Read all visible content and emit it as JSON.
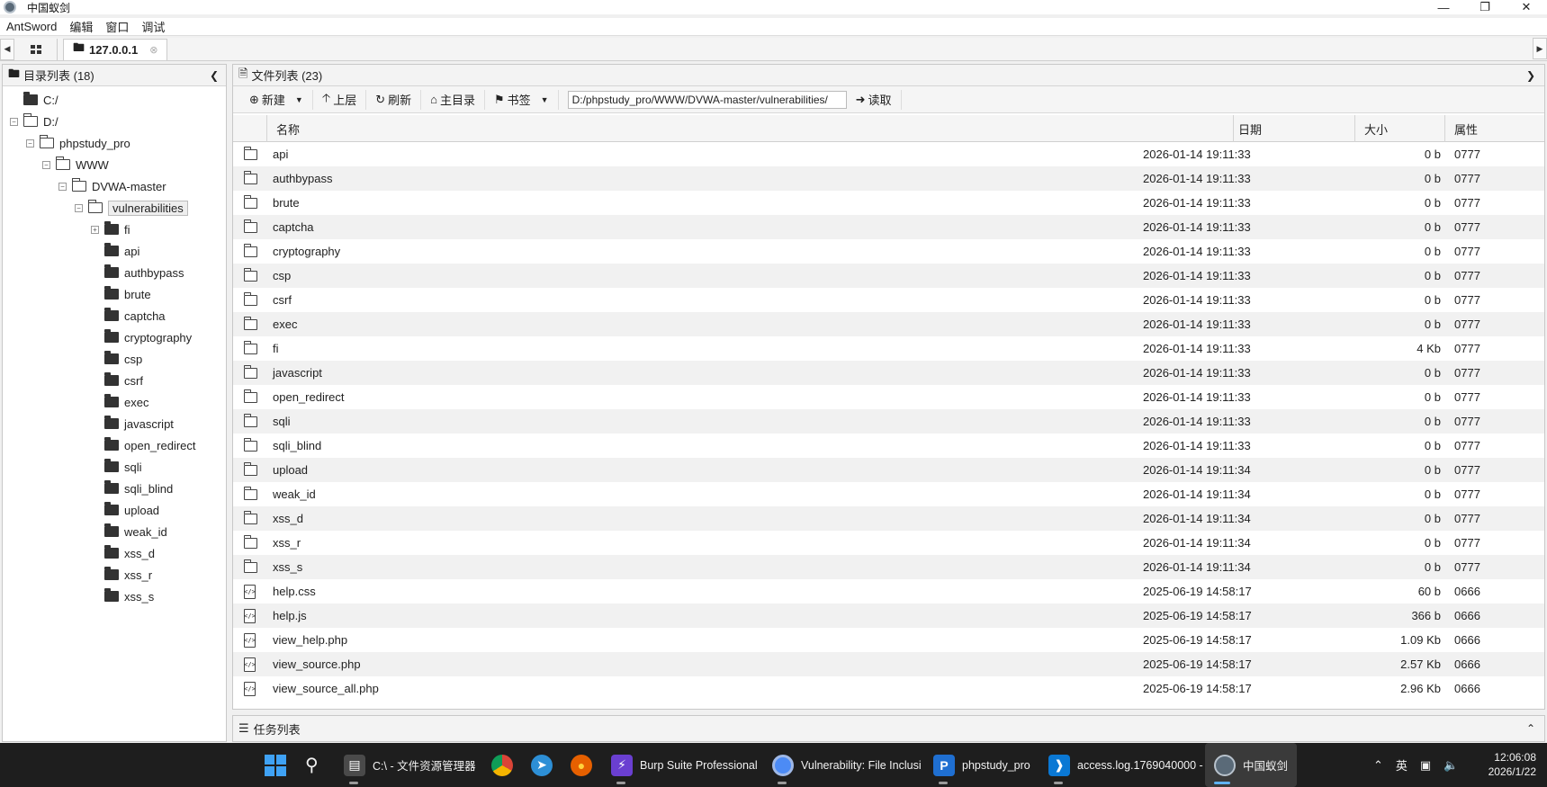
{
  "window": {
    "title": "中国蚁剑"
  },
  "menu": [
    "AntSword",
    "编辑",
    "窗口",
    "调试"
  ],
  "tabs": {
    "active_label": "127.0.0.1"
  },
  "dir_panel": {
    "title": "目录列表 (18)",
    "tree": [
      {
        "label": "C:/",
        "depth": 0,
        "icon": "solid",
        "expander": ""
      },
      {
        "label": "D:/",
        "depth": 0,
        "icon": "open",
        "expander": "-"
      },
      {
        "label": "phpstudy_pro",
        "depth": 1,
        "icon": "open",
        "expander": "-"
      },
      {
        "label": "WWW",
        "depth": 2,
        "icon": "open",
        "expander": "-"
      },
      {
        "label": "DVWA-master",
        "depth": 3,
        "icon": "open",
        "expander": "-"
      },
      {
        "label": "vulnerabilities",
        "depth": 4,
        "icon": "open",
        "expander": "-",
        "selected": true
      },
      {
        "label": "fi",
        "depth": 5,
        "icon": "solid",
        "expander": "+"
      },
      {
        "label": "api",
        "depth": 5,
        "icon": "solid",
        "expander": ""
      },
      {
        "label": "authbypass",
        "depth": 5,
        "icon": "solid",
        "expander": ""
      },
      {
        "label": "brute",
        "depth": 5,
        "icon": "solid",
        "expander": ""
      },
      {
        "label": "captcha",
        "depth": 5,
        "icon": "solid",
        "expander": ""
      },
      {
        "label": "cryptography",
        "depth": 5,
        "icon": "solid",
        "expander": ""
      },
      {
        "label": "csp",
        "depth": 5,
        "icon": "solid",
        "expander": ""
      },
      {
        "label": "csrf",
        "depth": 5,
        "icon": "solid",
        "expander": ""
      },
      {
        "label": "exec",
        "depth": 5,
        "icon": "solid",
        "expander": ""
      },
      {
        "label": "javascript",
        "depth": 5,
        "icon": "solid",
        "expander": ""
      },
      {
        "label": "open_redirect",
        "depth": 5,
        "icon": "solid",
        "expander": ""
      },
      {
        "label": "sqli",
        "depth": 5,
        "icon": "solid",
        "expander": ""
      },
      {
        "label": "sqli_blind",
        "depth": 5,
        "icon": "solid",
        "expander": ""
      },
      {
        "label": "upload",
        "depth": 5,
        "icon": "solid",
        "expander": ""
      },
      {
        "label": "weak_id",
        "depth": 5,
        "icon": "solid",
        "expander": ""
      },
      {
        "label": "xss_d",
        "depth": 5,
        "icon": "solid",
        "expander": ""
      },
      {
        "label": "xss_r",
        "depth": 5,
        "icon": "solid",
        "expander": ""
      },
      {
        "label": "xss_s",
        "depth": 5,
        "icon": "solid",
        "expander": ""
      }
    ]
  },
  "file_panel": {
    "title": "文件列表 (23)",
    "toolbar": {
      "new": "新建",
      "up": "上层",
      "refresh": "刷新",
      "home": "主目录",
      "bookmark": "书签",
      "path": "D:/phpstudy_pro/WWW/DVWA-master/vulnerabilities/",
      "read": "读取"
    },
    "columns": {
      "name": "名称",
      "date": "日期",
      "size": "大小",
      "attr": "属性"
    },
    "files": [
      {
        "name": "api",
        "date": "2026-01-14 19:11:33",
        "size": "0 b",
        "attr": "0777",
        "type": "folder"
      },
      {
        "name": "authbypass",
        "date": "2026-01-14 19:11:33",
        "size": "0 b",
        "attr": "0777",
        "type": "folder"
      },
      {
        "name": "brute",
        "date": "2026-01-14 19:11:33",
        "size": "0 b",
        "attr": "0777",
        "type": "folder"
      },
      {
        "name": "captcha",
        "date": "2026-01-14 19:11:33",
        "size": "0 b",
        "attr": "0777",
        "type": "folder"
      },
      {
        "name": "cryptography",
        "date": "2026-01-14 19:11:33",
        "size": "0 b",
        "attr": "0777",
        "type": "folder"
      },
      {
        "name": "csp",
        "date": "2026-01-14 19:11:33",
        "size": "0 b",
        "attr": "0777",
        "type": "folder"
      },
      {
        "name": "csrf",
        "date": "2026-01-14 19:11:33",
        "size": "0 b",
        "attr": "0777",
        "type": "folder"
      },
      {
        "name": "exec",
        "date": "2026-01-14 19:11:33",
        "size": "0 b",
        "attr": "0777",
        "type": "folder"
      },
      {
        "name": "fi",
        "date": "2026-01-14 19:11:33",
        "size": "4 Kb",
        "attr": "0777",
        "type": "folder"
      },
      {
        "name": "javascript",
        "date": "2026-01-14 19:11:33",
        "size": "0 b",
        "attr": "0777",
        "type": "folder"
      },
      {
        "name": "open_redirect",
        "date": "2026-01-14 19:11:33",
        "size": "0 b",
        "attr": "0777",
        "type": "folder"
      },
      {
        "name": "sqli",
        "date": "2026-01-14 19:11:33",
        "size": "0 b",
        "attr": "0777",
        "type": "folder"
      },
      {
        "name": "sqli_blind",
        "date": "2026-01-14 19:11:33",
        "size": "0 b",
        "attr": "0777",
        "type": "folder"
      },
      {
        "name": "upload",
        "date": "2026-01-14 19:11:34",
        "size": "0 b",
        "attr": "0777",
        "type": "folder"
      },
      {
        "name": "weak_id",
        "date": "2026-01-14 19:11:34",
        "size": "0 b",
        "attr": "0777",
        "type": "folder"
      },
      {
        "name": "xss_d",
        "date": "2026-01-14 19:11:34",
        "size": "0 b",
        "attr": "0777",
        "type": "folder"
      },
      {
        "name": "xss_r",
        "date": "2026-01-14 19:11:34",
        "size": "0 b",
        "attr": "0777",
        "type": "folder"
      },
      {
        "name": "xss_s",
        "date": "2026-01-14 19:11:34",
        "size": "0 b",
        "attr": "0777",
        "type": "folder"
      },
      {
        "name": "help.css",
        "date": "2025-06-19 14:58:17",
        "size": "60 b",
        "attr": "0666",
        "type": "code"
      },
      {
        "name": "help.js",
        "date": "2025-06-19 14:58:17",
        "size": "366 b",
        "attr": "0666",
        "type": "code"
      },
      {
        "name": "view_help.php",
        "date": "2025-06-19 14:58:17",
        "size": "1.09 Kb",
        "attr": "0666",
        "type": "code"
      },
      {
        "name": "view_source.php",
        "date": "2025-06-19 14:58:17",
        "size": "2.57 Kb",
        "attr": "0666",
        "type": "code"
      },
      {
        "name": "view_source_all.php",
        "date": "2025-06-19 14:58:17",
        "size": "2.96 Kb",
        "attr": "0666",
        "type": "code"
      }
    ]
  },
  "task_panel": {
    "title": "任务列表"
  },
  "taskbar": {
    "items": [
      {
        "label": "C:\\ - 文件资源管理器",
        "icon": "file-explorer-icon"
      },
      {
        "label": "",
        "icon": "chrome-icon"
      },
      {
        "label": "",
        "icon": "edge-icon"
      },
      {
        "label": "",
        "icon": "firefox-icon"
      },
      {
        "label": "Burp Suite Professional",
        "icon": "burp-icon"
      },
      {
        "label": "Vulnerability: File Inclusi",
        "icon": "chrome-icon"
      },
      {
        "label": "phpstudy_pro",
        "icon": "phpstudy-icon"
      },
      {
        "label": "access.log.1769040000 -",
        "icon": "vscode-icon"
      },
      {
        "label": "中国蚁剑",
        "icon": "antsword-icon"
      }
    ],
    "ime": "英",
    "time": "12:06:08",
    "date": "2026/1/22"
  },
  "colors": {
    "taskbar_bg": "#1e1e1e",
    "row_alt": "#f1f1f1",
    "selected_tree": "#eeeeee"
  }
}
